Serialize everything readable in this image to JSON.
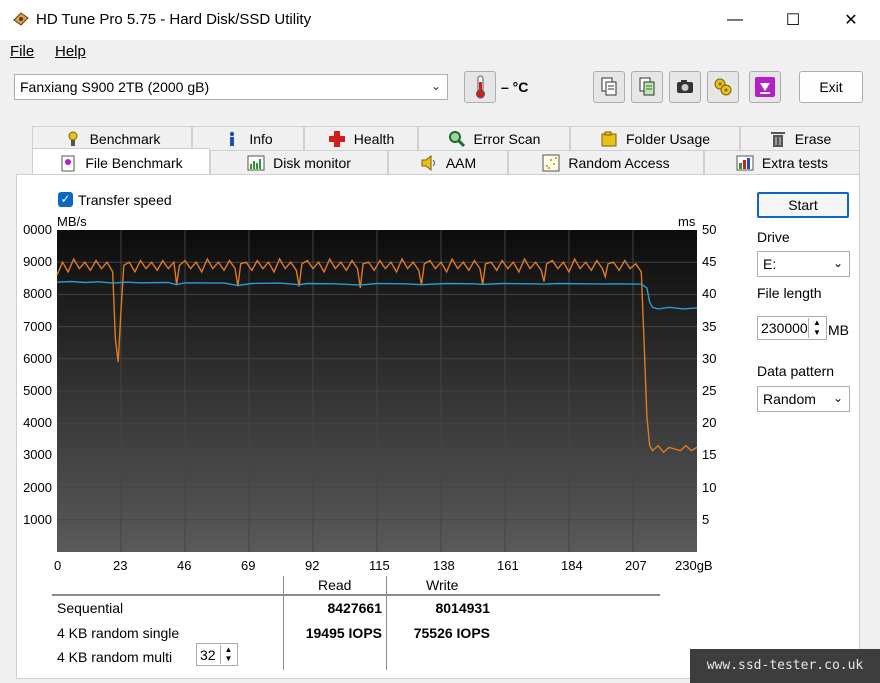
{
  "window": {
    "title": "HD Tune Pro 5.75 - Hard Disk/SSD Utility",
    "minimize": "—",
    "maximize": "☐",
    "close": "✕"
  },
  "menu": {
    "file": "File",
    "help": "Help"
  },
  "toolbar": {
    "drive": "Fanxiang S900 2TB (2000 gB)",
    "temperature": "– °C",
    "exit_label": "Exit",
    "icons": [
      "copy-icon",
      "copy-all-icon",
      "screenshot-icon",
      "options-icon",
      "save-icon"
    ]
  },
  "tabs_row1": [
    {
      "label": "Benchmark",
      "icon": "benchmark-icon"
    },
    {
      "label": "Info",
      "icon": "info-icon"
    },
    {
      "label": "Health",
      "icon": "health-icon"
    },
    {
      "label": "Error Scan",
      "icon": "error-scan-icon"
    },
    {
      "label": "Folder Usage",
      "icon": "folder-icon"
    },
    {
      "label": "Erase",
      "icon": "erase-icon"
    }
  ],
  "tabs_row2": [
    {
      "label": "File Benchmark",
      "icon": "file-benchmark-icon",
      "active": true
    },
    {
      "label": "Disk monitor",
      "icon": "disk-monitor-icon"
    },
    {
      "label": "AAM",
      "icon": "speaker-icon"
    },
    {
      "label": "Random Access",
      "icon": "random-access-icon"
    },
    {
      "label": "Extra tests",
      "icon": "extra-tests-icon"
    }
  ],
  "controls": {
    "transfer_speed_label": "Transfer speed",
    "transfer_speed_checked": true,
    "start_label": "Start",
    "drive_label": "Drive",
    "drive_value": "E:",
    "file_length_label": "File length",
    "file_length_value": "230000",
    "file_length_unit": "MB",
    "data_pattern_label": "Data pattern",
    "data_pattern_value": "Random"
  },
  "results": {
    "col_read": "Read",
    "col_write": "Write",
    "rows": [
      {
        "label": "Sequential",
        "read": "8427661",
        "write": "8014931"
      },
      {
        "label": "4 KB random single",
        "read": "19495 IOPS",
        "write": "75526 IOPS"
      },
      {
        "label": "4 KB random multi",
        "read": "",
        "write": ""
      }
    ],
    "queue_depth": "32"
  },
  "chart_data": {
    "type": "line",
    "ylabel": "MB/s",
    "y2label": "ms",
    "ylim": [
      0,
      10000
    ],
    "y2lim": [
      0,
      50
    ],
    "xlim": [
      0,
      230
    ],
    "grid": true,
    "y_ticks": [
      "0000",
      "9000",
      "8000",
      "7000",
      "6000",
      "5000",
      "4000",
      "3000",
      "2000",
      "1000"
    ],
    "y2_ticks": [
      "50",
      "45",
      "40",
      "35",
      "30",
      "25",
      "20",
      "15",
      "10",
      "5"
    ],
    "x_ticks": [
      "0",
      "23",
      "46",
      "69",
      "92",
      "115",
      "138",
      "161",
      "184",
      "207",
      "230gB"
    ],
    "series": [
      {
        "color": "#e07a1f",
        "x": [
          0,
          2,
          4,
          6,
          8,
          10,
          12,
          14,
          16,
          18,
          20,
          21,
          22,
          23,
          24,
          26,
          28,
          30,
          32,
          34,
          36,
          38,
          40,
          42,
          43,
          44,
          46,
          48,
          50,
          52,
          54,
          56,
          58,
          60,
          62,
          64,
          65,
          66,
          68,
          70,
          72,
          74,
          76,
          78,
          80,
          82,
          84,
          86,
          87,
          88,
          90,
          92,
          94,
          96,
          98,
          100,
          102,
          104,
          106,
          108,
          109,
          110,
          112,
          114,
          116,
          118,
          120,
          122,
          124,
          126,
          128,
          130,
          131,
          132,
          134,
          136,
          138,
          140,
          142,
          144,
          146,
          148,
          150,
          152,
          153,
          154,
          156,
          158,
          160,
          162,
          164,
          166,
          168,
          170,
          172,
          174,
          175,
          176,
          178,
          180,
          182,
          184,
          186,
          188,
          190,
          192,
          194,
          196,
          197,
          198,
          200,
          202,
          204,
          206,
          208,
          210,
          211,
          212,
          213,
          214,
          216,
          218,
          220,
          222,
          224,
          226,
          228,
          230
        ],
        "values": [
          8600,
          9000,
          8700,
          9100,
          8800,
          9000,
          8750,
          9050,
          8800,
          9000,
          8700,
          6600,
          5900,
          7500,
          8900,
          9000,
          8700,
          9050,
          8800,
          9000,
          8750,
          9050,
          8800,
          9000,
          8300,
          8900,
          9050,
          8800,
          9000,
          8700,
          9100,
          8800,
          9000,
          8750,
          9050,
          8800,
          8250,
          8950,
          9000,
          8750,
          9050,
          8800,
          9000,
          8700,
          9100,
          8800,
          9000,
          8750,
          8250,
          8950,
          9050,
          8800,
          9000,
          8700,
          9100,
          8800,
          9000,
          8750,
          9050,
          8800,
          8200,
          8950,
          9000,
          8750,
          9050,
          8800,
          9000,
          8700,
          9100,
          8800,
          9000,
          8750,
          8300,
          8950,
          9050,
          8800,
          9000,
          8700,
          9100,
          8800,
          9000,
          8750,
          9050,
          8800,
          8300,
          8950,
          9000,
          8750,
          9050,
          8800,
          9000,
          8700,
          9100,
          8800,
          9000,
          8750,
          8400,
          8950,
          9050,
          8800,
          9000,
          8700,
          9100,
          8800,
          9000,
          8750,
          9050,
          8800,
          8550,
          8950,
          9000,
          8750,
          9050,
          8800,
          8950,
          8700,
          6500,
          4200,
          3300,
          3150,
          3300,
          3100,
          3250,
          3200,
          3150,
          3300,
          3150,
          3250
        ]
      },
      {
        "color": "#2b9bd2",
        "x": [
          0,
          5,
          10,
          15,
          20,
          25,
          30,
          40,
          43,
          46,
          60,
          65,
          70,
          80,
          87,
          90,
          100,
          109,
          115,
          125,
          131,
          140,
          150,
          153,
          160,
          170,
          175,
          180,
          190,
          197,
          200,
          210,
          212,
          213,
          214,
          216,
          220,
          225,
          230
        ],
        "values": [
          8380,
          8400,
          8370,
          8390,
          8350,
          8380,
          8360,
          8370,
          8300,
          8360,
          8350,
          8280,
          8340,
          8350,
          8300,
          8340,
          8330,
          8290,
          8340,
          8330,
          8300,
          8340,
          8330,
          8310,
          8340,
          8330,
          8320,
          8340,
          8330,
          8320,
          8330,
          8320,
          8200,
          7750,
          7600,
          7550,
          7600,
          7550,
          7580
        ]
      }
    ]
  },
  "watermark": "www.ssd-tester.co.uk"
}
